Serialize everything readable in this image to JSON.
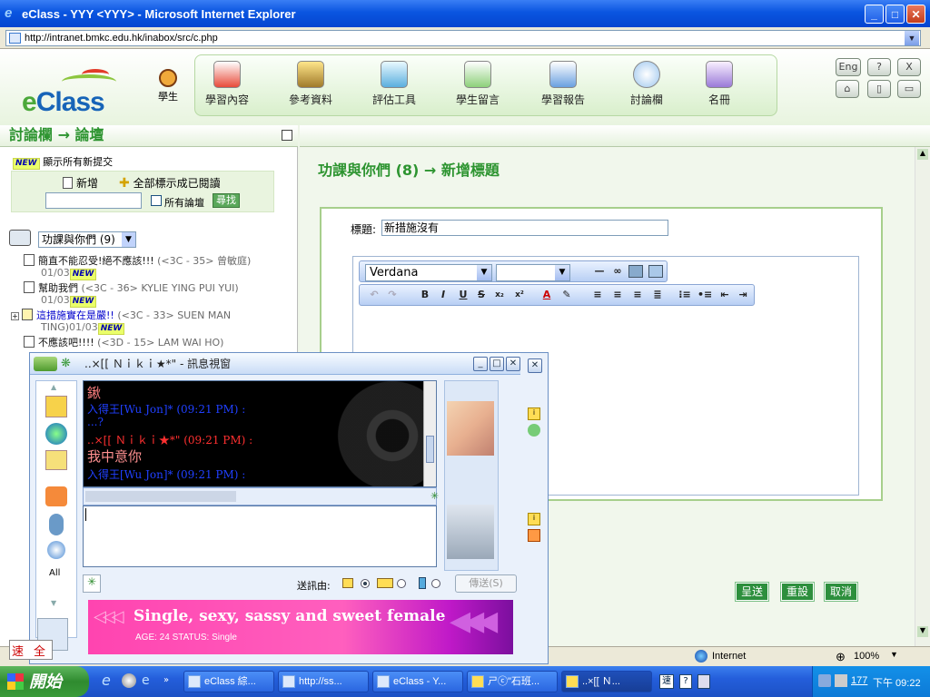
{
  "window": {
    "title": "eClass - YYY <YYY> - Microsoft Internet Explorer",
    "address": "http://intranet.bmkc.edu.hk/inabox/src/c.php"
  },
  "header": {
    "logo": "eClass",
    "student_label": "學生",
    "nav": [
      "學習內容",
      "參考資料",
      "評估工具",
      "學生留言",
      "學習報告",
      "討論欄",
      "名冊"
    ],
    "right_buttons": [
      "Eng",
      "?",
      "X"
    ]
  },
  "left": {
    "title": "討論欄 → 論壇",
    "new_badge": "NEW",
    "show_all_new": "顯示所有新提交",
    "add_label": "新增",
    "mark_all_read": "全部標示成已閱讀",
    "all_forums": "所有論壇",
    "search_btn": "尋找",
    "forum_select": "功課與你們 (9)",
    "posts": [
      {
        "title": "簡直不能忍受!絕不應該!!!",
        "meta": "(<3C - 35> 曾敏庭)",
        "date": "01/03"
      },
      {
        "title": "幫助我們",
        "meta": "(<3C - 36> KYLIE YING PUI YUI)",
        "date": "01/03"
      },
      {
        "title": "這措施實在是嚴!!",
        "meta": "(<3C - 33> SUEN MAN",
        "cont": "TING)",
        "date": "01/03"
      },
      {
        "title": "不應該吧!!!!",
        "meta": "(<3D - 15> LAM WAI HO)"
      }
    ]
  },
  "right": {
    "heading": "功課與你們 (8) → 新增標題",
    "subject_label": "標題:",
    "subject_value": "新措施沒有",
    "font_name": "Verdana",
    "font_size": "",
    "buttons": {
      "submit": "呈送",
      "reset": "重設",
      "cancel": "取消"
    }
  },
  "status": {
    "zone": "Internet",
    "zoom": "100%"
  },
  "chat": {
    "title": "..×[[ Ｎｉｋｉ★*\" - 訊息視窗",
    "messages": [
      {
        "text": "鍬",
        "color": "#ff8080",
        "size": "15px"
      },
      {
        "text": "入得王[Wu Jon]* (09:21 PM) :",
        "color": "#2040ff",
        "size": "12px"
      },
      {
        "text": "...?",
        "color": "#2040ff",
        "size": "12px"
      },
      {
        "text": "..×[[ Ｎｉｋｉ★*\" (09:21 PM) :",
        "color": "#ff3030",
        "size": "12px"
      },
      {
        "text": "我中意你",
        "color": "#ff9090",
        "size": "15px"
      },
      {
        "text": "入得王[Wu Jon]* (09:21 PM) :",
        "color": "#2040ff",
        "size": "12px"
      }
    ],
    "send_via": "送訊由:",
    "send_btn": "傳送(S)",
    "side_all": "All",
    "banner_title": "Single, sexy, sassy and sweet female",
    "banner_sub": "AGE: 24    STATUS: Single"
  },
  "ime": [
    "速",
    "全"
  ],
  "taskbar": {
    "start": "開始",
    "tasks": [
      "eClass 綜...",
      "http://ss...",
      "eClass - Y...",
      "ㄕⓒ\"石班...",
      "..×[[ Ｎ..."
    ],
    "time": "下午 09:22",
    "tray_num": "177"
  }
}
